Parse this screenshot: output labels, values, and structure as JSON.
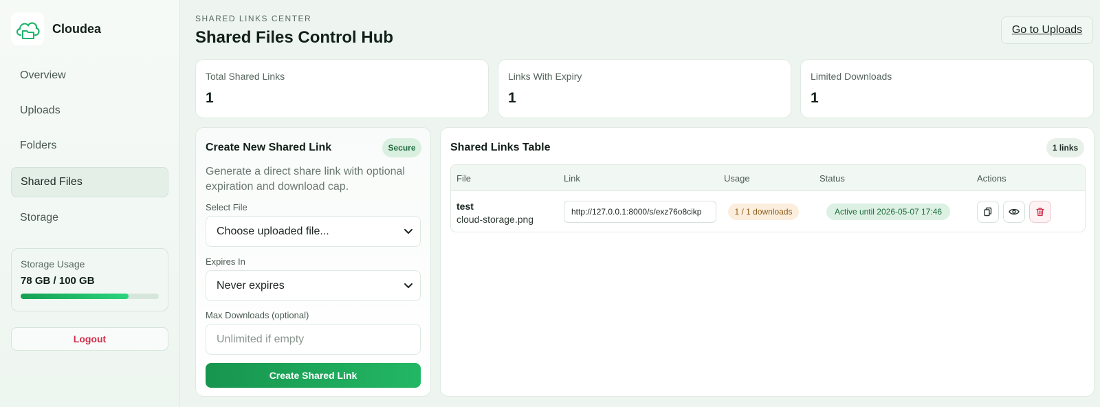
{
  "brand": {
    "name": "Cloudea"
  },
  "sidebar": {
    "items": [
      {
        "label": "Overview"
      },
      {
        "label": "Uploads"
      },
      {
        "label": "Folders"
      },
      {
        "label": "Shared Files",
        "active": true
      },
      {
        "label": "Storage"
      }
    ],
    "storage": {
      "label": "Storage Usage",
      "value": "78 GB / 100 GB",
      "percent": 78
    },
    "logout_label": "Logout"
  },
  "header": {
    "eyebrow": "SHARED LINKS CENTER",
    "title": "Shared Files Control Hub",
    "go_uploads_label": "Go to Uploads"
  },
  "stats": [
    {
      "label": "Total Shared Links",
      "value": "1"
    },
    {
      "label": "Links With Expiry",
      "value": "1"
    },
    {
      "label": "Limited Downloads",
      "value": "1"
    }
  ],
  "create_panel": {
    "title": "Create New Shared Link",
    "badge": "Secure",
    "description": "Generate a direct share link with optional expiration and download cap.",
    "select_file_label": "Select File",
    "select_file_value": "Choose uploaded file...",
    "expires_label": "Expires In",
    "expires_value": "Never expires",
    "max_downloads_label": "Max Downloads (optional)",
    "max_downloads_placeholder": "Unlimited if empty",
    "submit_label": "Create Shared Link"
  },
  "table_panel": {
    "title": "Shared Links Table",
    "count_badge": "1 links",
    "columns": [
      "File",
      "Link",
      "Usage",
      "Status",
      "Actions"
    ],
    "rows": [
      {
        "file_title": "test",
        "file_name": "cloud-storage.png",
        "link": "http://127.0.0.1:8000/s/exz76o8cikp",
        "usage": "1 / 1 downloads",
        "status": "Active until 2026-05-07 17:46"
      }
    ]
  },
  "colors": {
    "accent": "#1fa95c",
    "danger": "#d0314b",
    "warning_bg": "#fbeedd"
  },
  "icons": [
    "cloud-folder-icon",
    "chevron-down-icon",
    "copy-icon",
    "eye-icon",
    "trash-icon"
  ]
}
